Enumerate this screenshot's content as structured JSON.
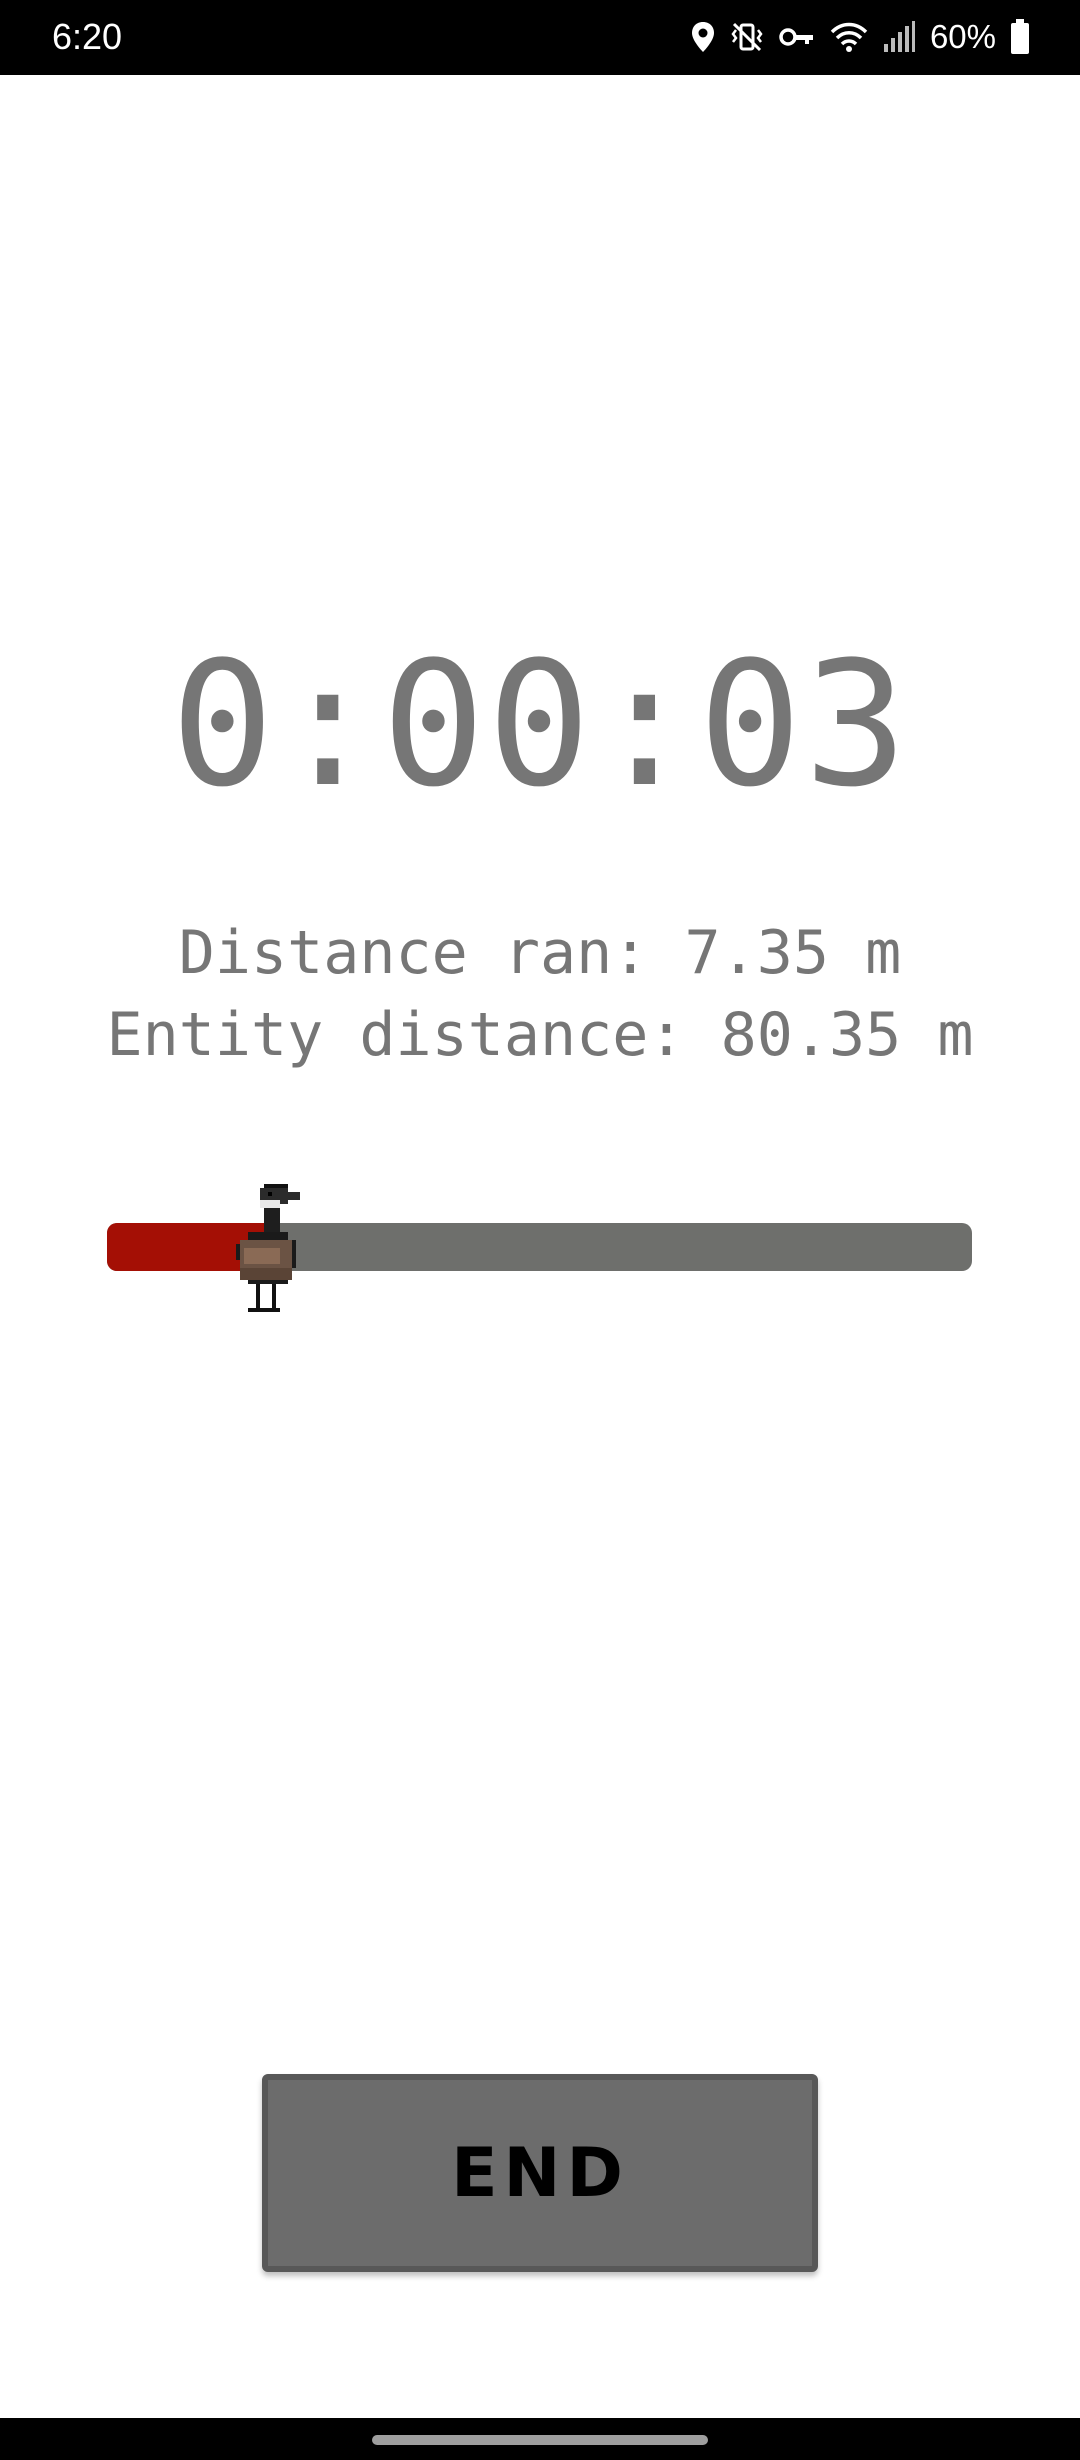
{
  "status_bar": {
    "time": "6:20",
    "battery_percent": "60%",
    "icons": [
      "location-icon",
      "vibrate-icon",
      "vpn-key-icon",
      "wifi-icon",
      "signal-icon",
      "battery-icon"
    ]
  },
  "run": {
    "timer": "0:00:03",
    "distance_ran": "Distance ran: 7.35 m",
    "entity_distance": "Entity distance: 80.35 m"
  },
  "progress": {
    "fill_fraction": 0.19,
    "fill_color": "#a40f05",
    "track_color": "#6e6f6c",
    "marker_icon": "goose-icon"
  },
  "end_button": {
    "label": "END"
  },
  "colors": {
    "text": "#767676",
    "button_bg": "#6c6c6c"
  }
}
